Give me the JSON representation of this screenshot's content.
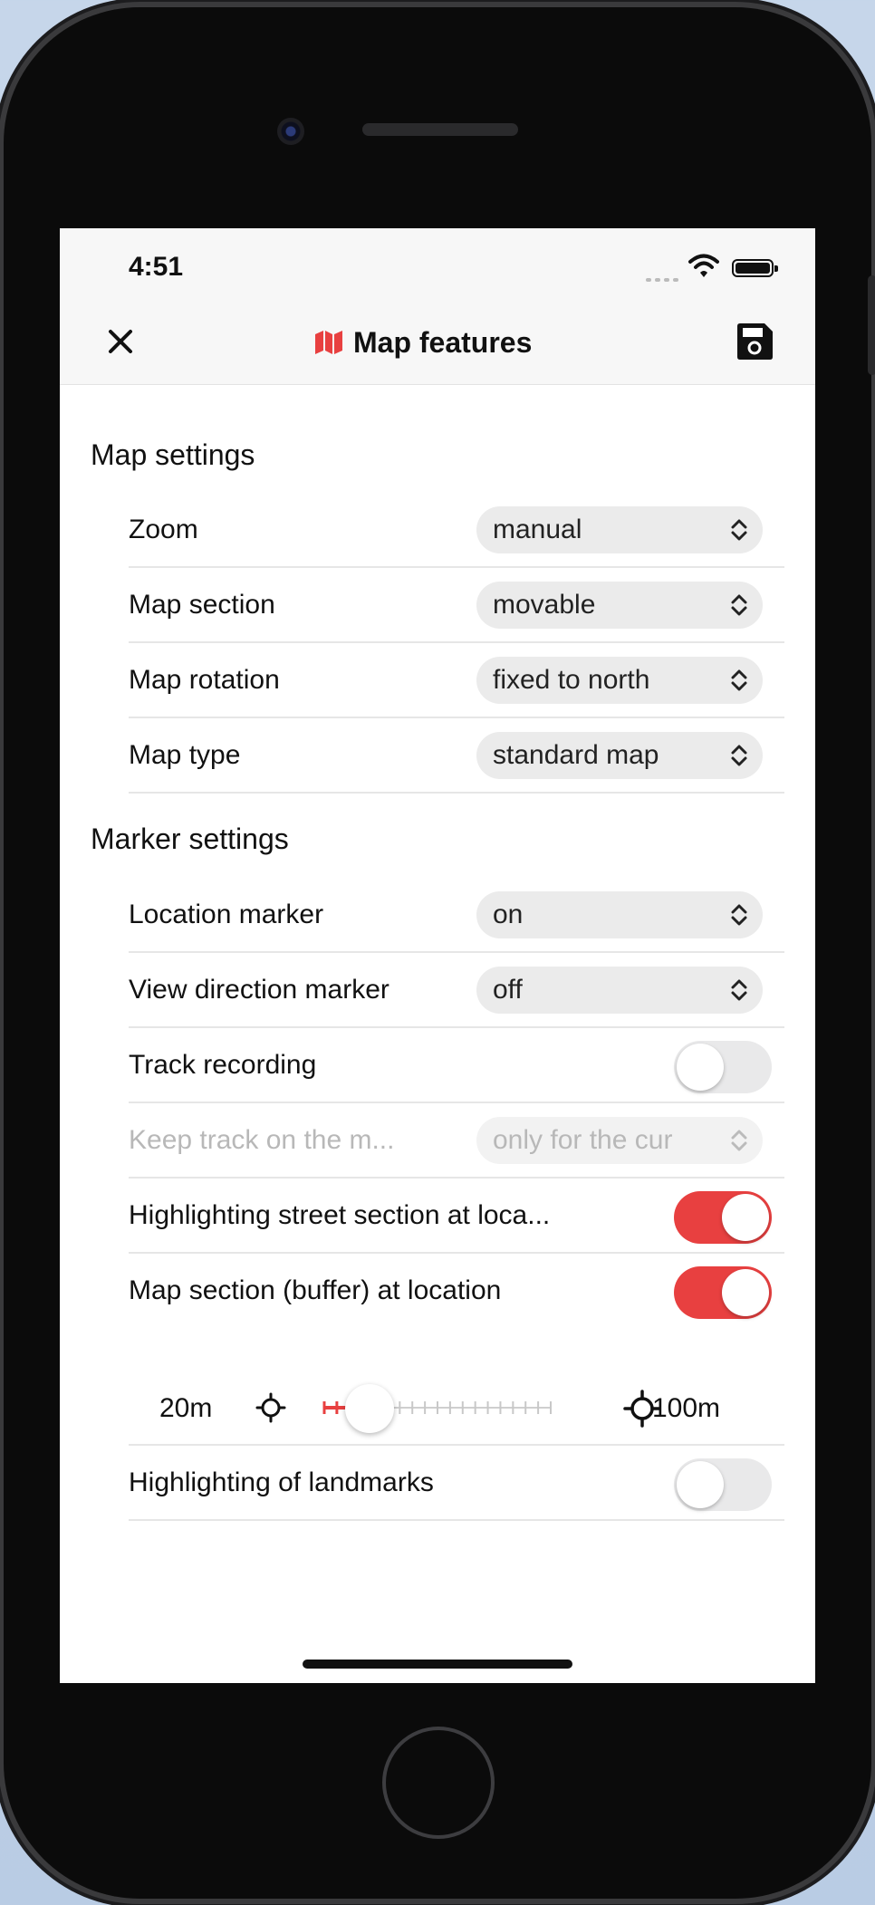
{
  "status_bar": {
    "time": "4:51"
  },
  "navbar": {
    "title": "Map features"
  },
  "sections": [
    {
      "title": "Map settings",
      "rows": [
        {
          "label": "Zoom",
          "type": "select",
          "value": "manual"
        },
        {
          "label": "Map section",
          "type": "select",
          "value": "movable"
        },
        {
          "label": "Map rotation",
          "type": "select",
          "value": "fixed to north"
        },
        {
          "label": "Map type",
          "type": "select",
          "value": "standard map"
        }
      ]
    },
    {
      "title": "Marker settings",
      "rows": [
        {
          "label": "Location marker",
          "type": "select",
          "value": "on"
        },
        {
          "label": "View direction marker",
          "type": "select",
          "value": "off"
        },
        {
          "label": "Track recording",
          "type": "toggle",
          "on": false
        },
        {
          "label": "Keep track on the m...",
          "type": "select",
          "value": "only for the cur",
          "disabled": true
        },
        {
          "label": "Highlighting street section at loca...",
          "type": "toggle",
          "on": true
        },
        {
          "label": "Map section (buffer) at location",
          "type": "toggle",
          "on": true
        }
      ]
    }
  ],
  "buffer_slider": {
    "min_label": "20m",
    "max_label": "100m",
    "min": 20,
    "max": 100,
    "value": 36
  },
  "landmarks_row": {
    "label": "Highlighting of landmarks",
    "type": "toggle",
    "on": false
  },
  "colors": {
    "accent": "#e84040",
    "toggle_off": "#e9e9ea",
    "select_bg": "#ebebeb"
  }
}
